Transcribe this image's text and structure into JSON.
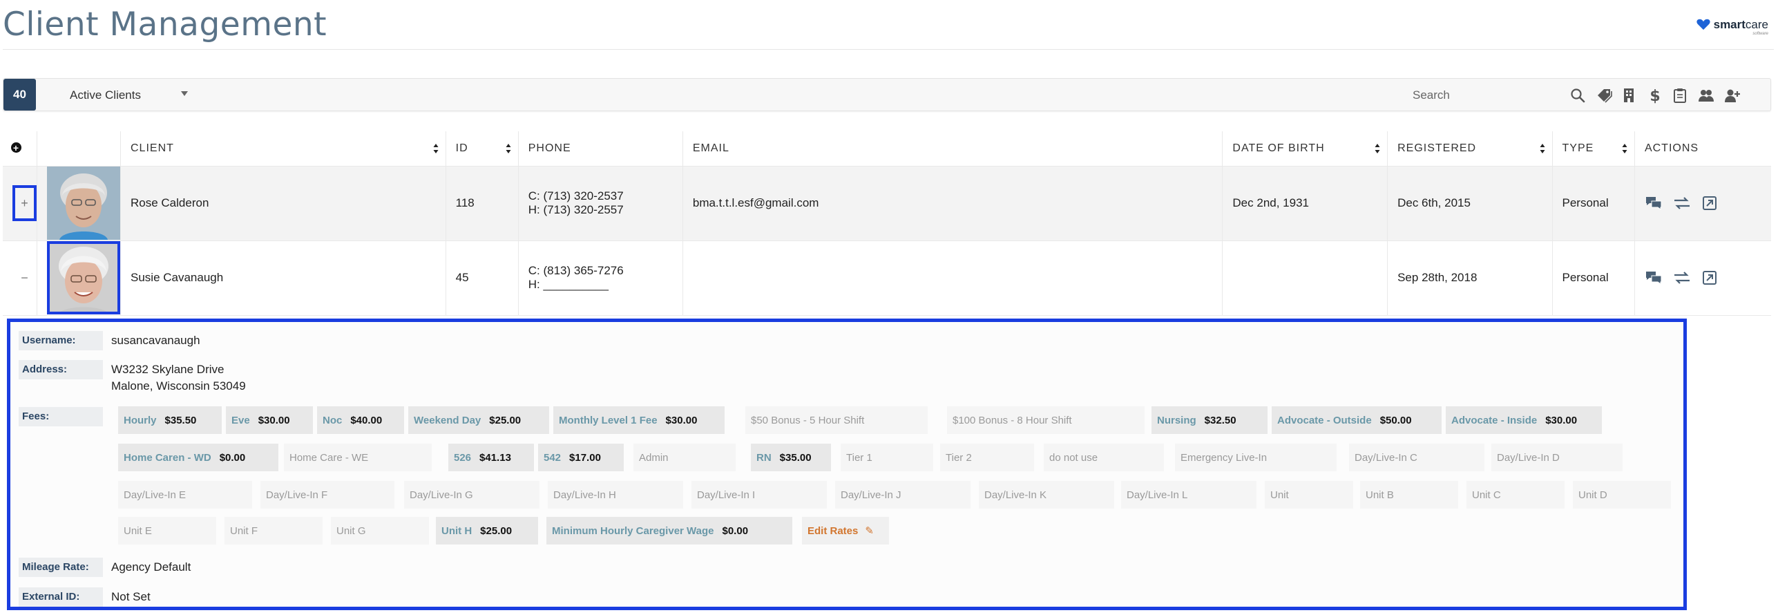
{
  "header": {
    "title": "Client Management",
    "logo": {
      "word1": "smart",
      "word2": "care",
      "sub": "software"
    }
  },
  "toolbar": {
    "count": "40",
    "filter": "Active Clients",
    "search_placeholder": "Search",
    "icons": [
      "search-icon",
      "tags-icon",
      "building-icon",
      "dollar-icon",
      "clipboard-icon",
      "users-icon",
      "add-user-icon"
    ]
  },
  "table": {
    "headers": {
      "client": "CLIENT",
      "id": "ID",
      "phone": "PHONE",
      "email": "EMAIL",
      "dob": "DATE OF BIRTH",
      "registered": "REGISTERED",
      "type": "TYPE",
      "actions": "ACTIONS"
    },
    "rows": [
      {
        "expand": "+",
        "name": "Rose Calderon",
        "id": "118",
        "phone_c": "C: (713) 320-2537",
        "phone_h": "H: (713) 320-2557",
        "email": "bma.t.t.l.esf@gmail.com",
        "dob": "Dec 2nd, 1931",
        "registered": "Dec 6th, 2015",
        "type": "Personal"
      },
      {
        "expand": "−",
        "name": "Susie Cavanaugh",
        "id": "45",
        "phone_c": "C: (813) 365-7276",
        "phone_h": "H: __________",
        "email": "",
        "dob": "",
        "registered": "Sep 28th, 2018",
        "type": "Personal"
      }
    ]
  },
  "details": {
    "username_label": "Username:",
    "username": "susancavanaugh",
    "address_label": "Address:",
    "address_line1": "W3232 Skylane Drive",
    "address_line2": "Malone, Wisconsin 53049",
    "fees_label": "Fees:",
    "mileage_label": "Mileage Rate:",
    "mileage": "Agency Default",
    "external_label": "External ID:",
    "external": "Not Set",
    "fees": [
      {
        "name": "Hourly",
        "amount": "$35.50"
      },
      {
        "name": "Eve",
        "amount": "$30.00"
      },
      {
        "name": "Noc",
        "amount": "$40.00"
      },
      {
        "name": "Weekend Day",
        "amount": "$25.00"
      },
      {
        "name": "Monthly Level 1 Fee",
        "amount": "$30.00"
      },
      {
        "name": "$50 Bonus - 5 Hour Shift",
        "amount": ""
      },
      {
        "name": "$100 Bonus - 8 Hour Shift",
        "amount": ""
      },
      {
        "name": "Nursing",
        "amount": "$32.50"
      },
      {
        "name": "Advocate - Outside",
        "amount": "$50.00"
      },
      {
        "name": "Advocate - Inside",
        "amount": "$30.00"
      },
      {
        "name": "Home Caren - WD",
        "amount": "$0.00"
      },
      {
        "name": "Home Care - WE",
        "amount": ""
      },
      {
        "name": "526",
        "amount": "$41.13"
      },
      {
        "name": "542",
        "amount": "$17.00"
      },
      {
        "name": "Admin",
        "amount": ""
      },
      {
        "name": "RN",
        "amount": "$35.00"
      },
      {
        "name": "Tier 1",
        "amount": ""
      },
      {
        "name": "Tier 2",
        "amount": ""
      },
      {
        "name": "do not use",
        "amount": ""
      },
      {
        "name": "Emergency Live-In",
        "amount": ""
      },
      {
        "name": "Day/Live-In C",
        "amount": ""
      },
      {
        "name": "Day/Live-In D",
        "amount": ""
      },
      {
        "name": "Day/Live-In E",
        "amount": ""
      },
      {
        "name": "Day/Live-In F",
        "amount": ""
      },
      {
        "name": "Day/Live-In G",
        "amount": ""
      },
      {
        "name": "Day/Live-In H",
        "amount": ""
      },
      {
        "name": "Day/Live-In I",
        "amount": ""
      },
      {
        "name": "Day/Live-In J",
        "amount": ""
      },
      {
        "name": "Day/Live-In K",
        "amount": ""
      },
      {
        "name": "Day/Live-In L",
        "amount": ""
      },
      {
        "name": "Unit",
        "amount": ""
      },
      {
        "name": "Unit B",
        "amount": ""
      },
      {
        "name": "Unit C",
        "amount": ""
      },
      {
        "name": "Unit D",
        "amount": ""
      },
      {
        "name": "Unit E",
        "amount": ""
      },
      {
        "name": "Unit F",
        "amount": ""
      },
      {
        "name": "Unit G",
        "amount": ""
      },
      {
        "name": "Unit H",
        "amount": "$25.00"
      },
      {
        "name": "Minimum Hourly Caregiver Wage",
        "amount": "$0.00"
      },
      {
        "name": "Edit Rates",
        "amount": ""
      }
    ]
  },
  "colors": {
    "accent": "#2b4664",
    "highlight": "#1a3de0",
    "fee_name": "#6a98a8",
    "edit": "#d2762f"
  }
}
